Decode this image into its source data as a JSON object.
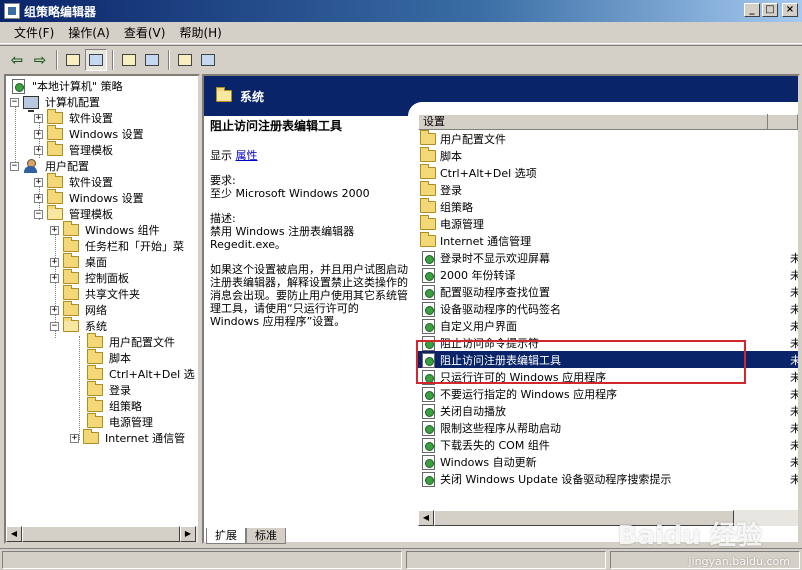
{
  "window": {
    "title": "组策略编辑器"
  },
  "menu": [
    "文件(F)",
    "操作(A)",
    "查看(V)",
    "帮助(H)"
  ],
  "window_buttons": [
    "_",
    "□",
    "×"
  ],
  "tree": {
    "root": "\"本地计算机\" 策略",
    "computer": "计算机配置",
    "computer_children": [
      "软件设置",
      "Windows 设置",
      "管理模板"
    ],
    "user": "用户配置",
    "user_children": [
      "软件设置",
      "Windows 设置",
      "管理模板"
    ],
    "admin_children": [
      "Windows 组件",
      "任务栏和「开始」菜",
      "桌面",
      "控制面板",
      "共享文件夹",
      "网络",
      "系统"
    ],
    "system_children": [
      "用户配置文件",
      "脚本",
      "Ctrl+Alt+Del 选",
      "登录",
      "组策略",
      "电源管理",
      "Internet 通信管"
    ]
  },
  "header": {
    "title": "系统"
  },
  "description": {
    "title": "阻止访问注册表编辑工具",
    "show_label": "显示",
    "properties_link": "属性",
    "requirements_label": "要求:",
    "requirements_value": "至少 Microsoft Windows 2000",
    "desc_label": "描述:",
    "desc_line1": "禁用 Windows 注册表编辑器",
    "desc_line2": "Regedit.exe。",
    "detail": "如果这个设置被启用，并且用户试图启动注册表编辑器，解释设置禁止这类操作的消息会出现。要防止用户使用其它系统管理工具，请使用“只运行许可的 Windows 应用程序”设置。"
  },
  "list": {
    "column_header": "设置",
    "folders": [
      "用户配置文件",
      "脚本",
      "Ctrl+Alt+Del 选项",
      "登录",
      "组策略",
      "电源管理",
      "Internet 通信管理"
    ],
    "policies": [
      "登录时不显示欢迎屏幕",
      "2000 年份转译",
      "配置驱动程序查找位置",
      "设备驱动程序的代码签名",
      "自定义用户界面",
      "阻止访问命令提示符",
      "阻止访问注册表编辑工具",
      "只运行许可的 Windows 应用程序",
      "不要运行指定的 Windows 应用程序",
      "关闭自动播放",
      "限制这些程序从帮助启动",
      "下载丢失的 COM 组件",
      "Windows 自动更新",
      "关闭 Windows Update 设备驱动程序搜索提示"
    ],
    "selected_index": 6,
    "state_glyph": "未"
  },
  "tabs": [
    "扩展",
    "标准"
  ],
  "watermark": {
    "brand": "Baidu 经验",
    "url": "jingyan.baidu.com"
  },
  "colors": {
    "title_bar": "#0a246a",
    "selection": "#0a246a",
    "highlight_box": "#d0282d"
  }
}
